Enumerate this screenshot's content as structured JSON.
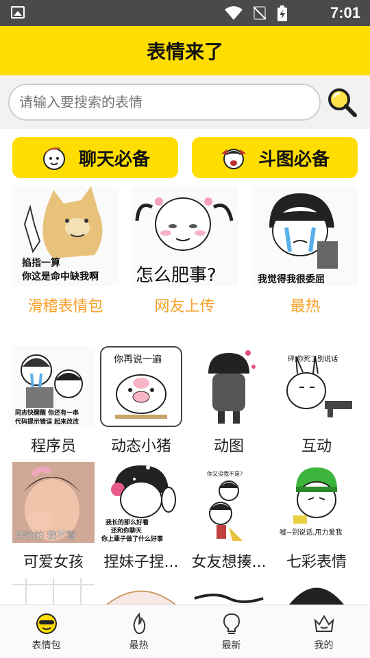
{
  "status_bar": {
    "time": "7:01"
  },
  "header": {
    "title": "表情来了"
  },
  "search": {
    "placeholder": "请输入要搜索的表情"
  },
  "categories": [
    {
      "label": "聊天必备"
    },
    {
      "label": "斗图必备"
    }
  ],
  "featured": [
    {
      "caption": "滑稽表情包",
      "image_text_1": "掐指一算",
      "image_text_2": "你这是命中缺我啊"
    },
    {
      "caption": "网友上传",
      "image_text_1": "怎么肥事?"
    },
    {
      "caption": "最热",
      "image_text_1": "我觉得我很委屈"
    }
  ],
  "grid": [
    {
      "caption": "程序员",
      "image_text_1": "同志快醒醒 你还有一串",
      "image_text_2": "代码提示错误 起来改改"
    },
    {
      "caption": "动态小猪",
      "image_text_1": "你再说一遍"
    },
    {
      "caption": "动图"
    },
    {
      "caption": "互动",
      "image_text_1": "砰,你死了别说话"
    },
    {
      "caption": "可爱女孩",
      "image_text_1": "好怕怕 我不管"
    },
    {
      "caption": "捏妹子捏...",
      "image_text_1": "我长的那么好看",
      "image_text_2": "还和你聊天",
      "image_text_3": "你上辈子做了什么好事"
    },
    {
      "caption": "女友想揍...",
      "image_text_1": "你又没我不是?"
    },
    {
      "caption": "七彩表情",
      "image_text_1": "嘘~别说话,用力爱我"
    }
  ],
  "bottom_nav": [
    {
      "label": "表情包",
      "icon": "smiley-icon"
    },
    {
      "label": "最热",
      "icon": "flame-icon"
    },
    {
      "label": "最新",
      "icon": "bulb-icon"
    },
    {
      "label": "我的",
      "icon": "crown-icon"
    }
  ]
}
